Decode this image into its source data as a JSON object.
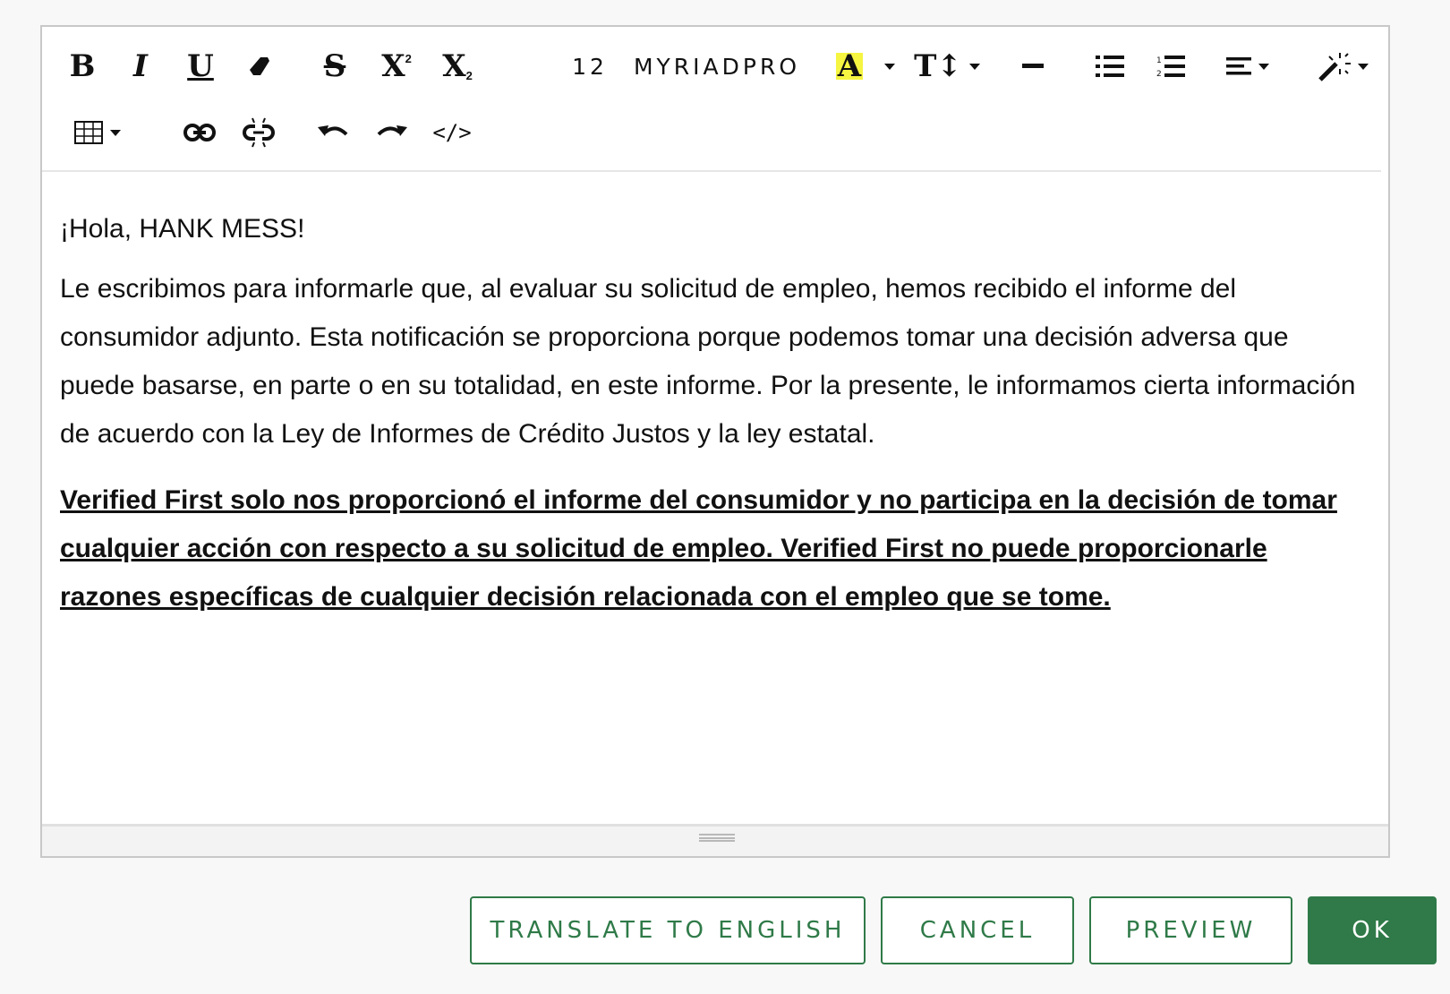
{
  "toolbar": {
    "font_size": "12",
    "font_name": "MYRIADPRO",
    "highlight_color": "#f5f542",
    "icons": [
      "bold-icon",
      "italic-icon",
      "underline-icon",
      "eraser-icon",
      "strikethrough-icon",
      "superscript-icon",
      "subscript-icon",
      "text-color-icon",
      "font-size-icon",
      "horizontal-rule-icon",
      "bullet-list-icon",
      "numbered-list-icon",
      "align-icon",
      "magic-wand-icon",
      "table-icon",
      "link-icon",
      "unlink-icon",
      "undo-icon",
      "redo-icon",
      "code-view-icon"
    ]
  },
  "content": {
    "greeting": "¡Hola, HANK MESS!",
    "paragraph1": "Le escribimos para informarle que, al evaluar su solicitud de empleo, hemos recibido el informe del consumidor adjunto. Esta notificación se proporciona porque podemos tomar una decisión adversa que puede basarse, en parte o en su totalidad, en este informe. Por la presente, le informamos cierta información de acuerdo con la Ley de Informes de Crédito Justos y la ley estatal.",
    "paragraph2": "Verified First solo nos proporcionó el informe del consumidor y no participa en la decisión de tomar cualquier acción con respecto a su solicitud de empleo. Verified First no puede proporcionarle razones específicas de cualquier decisión relacionada con el empleo que se tome."
  },
  "actions": {
    "translate_label": "TRANSLATE TO ENGLISH",
    "cancel_label": "CANCEL",
    "preview_label": "PREVIEW",
    "ok_label": "OK"
  },
  "colors": {
    "accent": "#2f7a48",
    "border": "#c8c8c8",
    "background": "#f8f8f8"
  }
}
